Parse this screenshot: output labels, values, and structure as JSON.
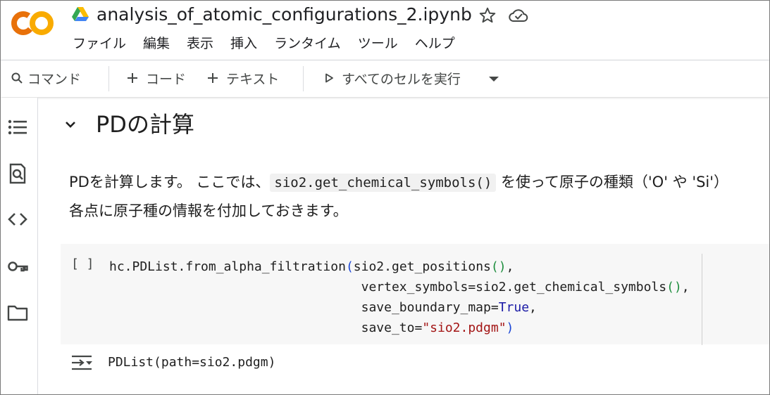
{
  "header": {
    "notebook_title": "analysis_of_atomic_configurations_2.ipynb",
    "logo_text": "CO",
    "menu": [
      "ファイル",
      "編集",
      "表示",
      "挿入",
      "ランタイム",
      "ツール",
      "ヘルプ"
    ]
  },
  "toolbar": {
    "command": "コマンド",
    "add_code": "コード",
    "add_text": "テキスト",
    "run_all": "すべてのセルを実行"
  },
  "rail": {
    "icons": [
      "table-of-contents-icon",
      "find-replace-icon",
      "code-snippets-icon",
      "secrets-key-icon",
      "files-folder-icon"
    ]
  },
  "section": {
    "title": "PDの計算"
  },
  "markdown": {
    "line1_before": "PDを計算します。 ここでは、",
    "line1_code": "sio2.get_chemical_symbols()",
    "line1_after": " を使って原子の種類（'O' や 'Si'）",
    "line2": "各点に原子種の情報を付加しておきます。"
  },
  "code_cell": {
    "run_bracket": "[ ]",
    "lines": [
      {
        "parts": [
          "hc.PDList.from_alpha_filtration",
          "(",
          "sio2.get_positions",
          "()",
          ","
        ]
      },
      {
        "parts": [
          "                                 vertex_symbols=sio2.get_chemical_symbols",
          "()",
          ","
        ]
      },
      {
        "parts": [
          "                                 save_boundary_map=",
          "True",
          ","
        ]
      },
      {
        "parts": [
          "                                 save_to=",
          "\"sio2.pdgm\"",
          ")"
        ]
      }
    ]
  },
  "output": {
    "text": "PDList(path=sio2.pdgm)"
  },
  "colors": {
    "logo_orange": "#F9AB00",
    "logo_dark_orange": "#E8710A",
    "paren_green": "#1e8e3e",
    "paren_blue": "#1a46d6",
    "keyword_blue": "#1a1aa6",
    "string_red": "#a31515"
  }
}
